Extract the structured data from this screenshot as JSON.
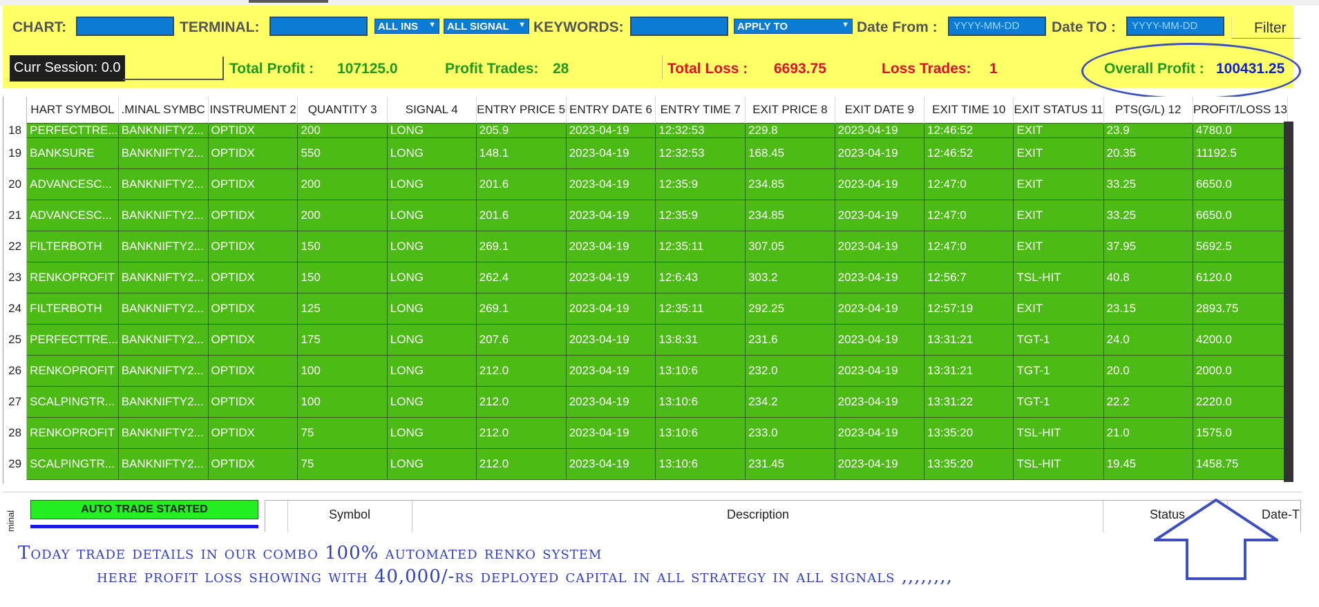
{
  "filters": {
    "chart_label": "CHART:",
    "terminal_label": "TERMINAL:",
    "instrument_combo": "ALL INS",
    "signal_combo": "ALL SIGNAL",
    "keywords_label": "KEYWORDS:",
    "apply_combo": "APPLY TO",
    "date_from_label": "Date From :",
    "date_from_placeholder": "YYYY-MM-DD",
    "date_to_label": "Date TO :",
    "date_to_placeholder": "YYYY-MM-DD",
    "filter_button": "Filter"
  },
  "summary": {
    "session": "Curr Session: 0.0",
    "total_profit_label": "Total Profit :",
    "total_profit": "107125.0",
    "profit_trades_label": "Profit Trades:",
    "profit_trades": "28",
    "total_loss_label": "Total Loss :",
    "total_loss": "6693.75",
    "loss_trades_label": "Loss Trades:",
    "loss_trades": "1",
    "overall_profit_label": "Overall Profit :",
    "overall_profit": "100431.25"
  },
  "table": {
    "headers": [
      "HART SYMBOL",
      ".MINAL SYMBC",
      "INSTRUMENT 2",
      "QUANTITY 3",
      "SIGNAL 4",
      "ENTRY PRICE 5",
      "ENTRY DATE 6",
      "ENTRY TIME 7",
      "EXIT PRICE 8",
      "EXIT DATE 9",
      "EXIT TIME 10",
      "EXIT STATUS 11",
      "PTS(G/L) 12",
      "PROFIT/LOSS 13"
    ],
    "rows": [
      [
        "18",
        "PERFECTTRE...",
        "BANKNIFTY2...",
        "OPTIDX",
        "200",
        "LONG",
        "205.9",
        "2023-04-19",
        "12:32:53",
        "229.8",
        "2023-04-19",
        "12:46:52",
        "EXIT",
        "23.9",
        "4780.0"
      ],
      [
        "19",
        "BANKSURE",
        "BANKNIFTY2...",
        "OPTIDX",
        "550",
        "LONG",
        "148.1",
        "2023-04-19",
        "12:32:53",
        "168.45",
        "2023-04-19",
        "12:46:52",
        "EXIT",
        "20.35",
        "11192.5"
      ],
      [
        "20",
        "ADVANCESC...",
        "BANKNIFTY2...",
        "OPTIDX",
        "200",
        "LONG",
        "201.6",
        "2023-04-19",
        "12:35:9",
        "234.85",
        "2023-04-19",
        "12:47:0",
        "EXIT",
        "33.25",
        "6650.0"
      ],
      [
        "21",
        "ADVANCESC...",
        "BANKNIFTY2...",
        "OPTIDX",
        "200",
        "LONG",
        "201.6",
        "2023-04-19",
        "12:35:9",
        "234.85",
        "2023-04-19",
        "12:47:0",
        "EXIT",
        "33.25",
        "6650.0"
      ],
      [
        "22",
        "FILTERBOTH",
        "BANKNIFTY2...",
        "OPTIDX",
        "150",
        "LONG",
        "269.1",
        "2023-04-19",
        "12:35:11",
        "307.05",
        "2023-04-19",
        "12:47:0",
        "EXIT",
        "37.95",
        "5692.5"
      ],
      [
        "23",
        "RENKOPROFIT",
        "BANKNIFTY2...",
        "OPTIDX",
        "150",
        "LONG",
        "262.4",
        "2023-04-19",
        "12:6:43",
        "303.2",
        "2023-04-19",
        "12:56:7",
        "TSL-HIT",
        "40.8",
        "6120.0"
      ],
      [
        "24",
        "FILTERBOTH",
        "BANKNIFTY2...",
        "OPTIDX",
        "125",
        "LONG",
        "269.1",
        "2023-04-19",
        "12:35:11",
        "292.25",
        "2023-04-19",
        "12:57:19",
        "EXIT",
        "23.15",
        "2893.75"
      ],
      [
        "25",
        "PERFECTTRE...",
        "BANKNIFTY2...",
        "OPTIDX",
        "175",
        "LONG",
        "207.6",
        "2023-04-19",
        "13:8:31",
        "231.6",
        "2023-04-19",
        "13:31:21",
        "TGT-1",
        "24.0",
        "4200.0"
      ],
      [
        "26",
        "RENKOPROFIT",
        "BANKNIFTY2...",
        "OPTIDX",
        "100",
        "LONG",
        "212.0",
        "2023-04-19",
        "13:10:6",
        "232.0",
        "2023-04-19",
        "13:31:21",
        "TGT-1",
        "20.0",
        "2000.0"
      ],
      [
        "27",
        "SCALPINGTR...",
        "BANKNIFTY2...",
        "OPTIDX",
        "100",
        "LONG",
        "212.0",
        "2023-04-19",
        "13:10:6",
        "234.2",
        "2023-04-19",
        "13:31:22",
        "TGT-1",
        "22.2",
        "2220.0"
      ],
      [
        "28",
        "RENKOPROFIT",
        "BANKNIFTY2...",
        "OPTIDX",
        "75",
        "LONG",
        "212.0",
        "2023-04-19",
        "13:10:6",
        "233.0",
        "2023-04-19",
        "13:35:20",
        "TSL-HIT",
        "21.0",
        "1575.0"
      ],
      [
        "29",
        "SCALPINGTR...",
        "BANKNIFTY2...",
        "OPTIDX",
        "75",
        "LONG",
        "212.0",
        "2023-04-19",
        "13:10:6",
        "231.45",
        "2023-04-19",
        "13:35:20",
        "TSL-HIT",
        "19.45",
        "1458.75"
      ]
    ]
  },
  "bottom": {
    "side_tab": "minal",
    "auto_trade": "AUTO TRADE STARTED",
    "col_symbol": "Symbol",
    "col_description": "Description",
    "col_status": "Status",
    "col_date": "Date-T"
  },
  "caption": {
    "line1": "Today trade details in our combo 100% automated renko system",
    "line2": "here profit loss showing with 40,000/-rs deployed capital in all strategy in all signals ,,,,,,,,"
  },
  "colors": {
    "panel_bg": "#ffff66",
    "row_green": "#4cbb16",
    "profit_green": "#1e9a1e",
    "loss_red": "#e0102a",
    "overall_blue": "#1020d0",
    "annotation_blue": "#3c4fc0"
  }
}
